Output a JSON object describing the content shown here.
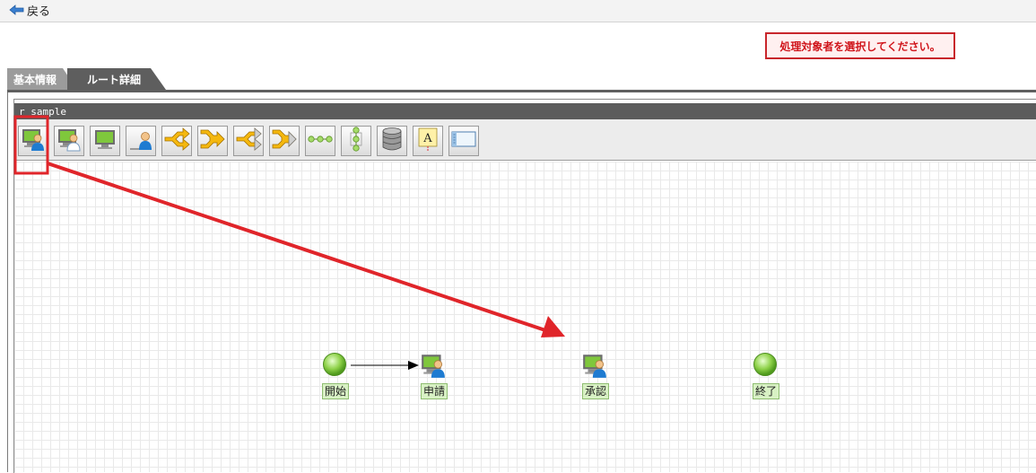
{
  "header": {
    "back_label": "戻る"
  },
  "message": {
    "error_text": "処理対象者を選択してください。"
  },
  "tabs": [
    {
      "label": "基本情報",
      "active": false
    },
    {
      "label": "ルート詳細",
      "active": true
    }
  ],
  "route": {
    "name": "r sample"
  },
  "toolbar": {
    "tools": [
      {
        "icon": "user-node-icon",
        "highlighted": true
      },
      {
        "icon": "user-node-alt-icon"
      },
      {
        "icon": "monitor-node-icon"
      },
      {
        "icon": "person-node-icon"
      },
      {
        "icon": "branch-split-icon"
      },
      {
        "icon": "branch-join-icon"
      },
      {
        "icon": "branch-split-gray-icon"
      },
      {
        "icon": "branch-join-gray-icon"
      },
      {
        "icon": "horizontal-connector-icon"
      },
      {
        "icon": "vertical-connector-icon"
      },
      {
        "icon": "database-icon"
      },
      {
        "icon": "text-note-icon"
      },
      {
        "icon": "window-frame-icon"
      }
    ]
  },
  "flow": {
    "nodes": [
      {
        "id": "start",
        "label": "開始",
        "type": "circle"
      },
      {
        "id": "apply",
        "label": "申請",
        "type": "user"
      },
      {
        "id": "approve",
        "label": "承認",
        "type": "user"
      },
      {
        "id": "end",
        "label": "終了",
        "type": "circle"
      }
    ],
    "edges": [
      {
        "from": "開始",
        "to": "申請"
      }
    ]
  },
  "colors": {
    "annotation_red": "#e0252a",
    "node_green": "#7fc73c",
    "error_border": "#c8262b",
    "tab_dark": "#5e5e5e",
    "tab_light": "#9b9b9b"
  }
}
